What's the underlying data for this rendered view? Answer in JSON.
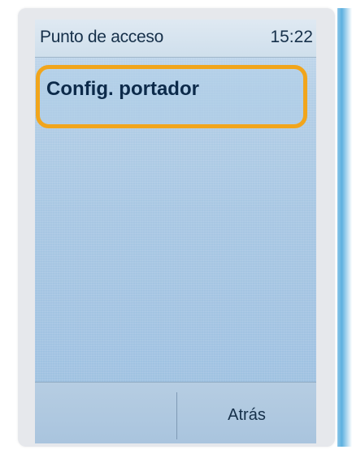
{
  "status_bar": {
    "title": "Punto de acceso",
    "time": "15:22"
  },
  "list": {
    "items": [
      {
        "label": "Config. portador",
        "highlighted": true
      }
    ]
  },
  "softkeys": {
    "left": "",
    "right": "Atrás"
  },
  "colors": {
    "highlight_ring": "#f1a51c",
    "screen_bg": "#a8c7e3",
    "text": "#16304a"
  }
}
